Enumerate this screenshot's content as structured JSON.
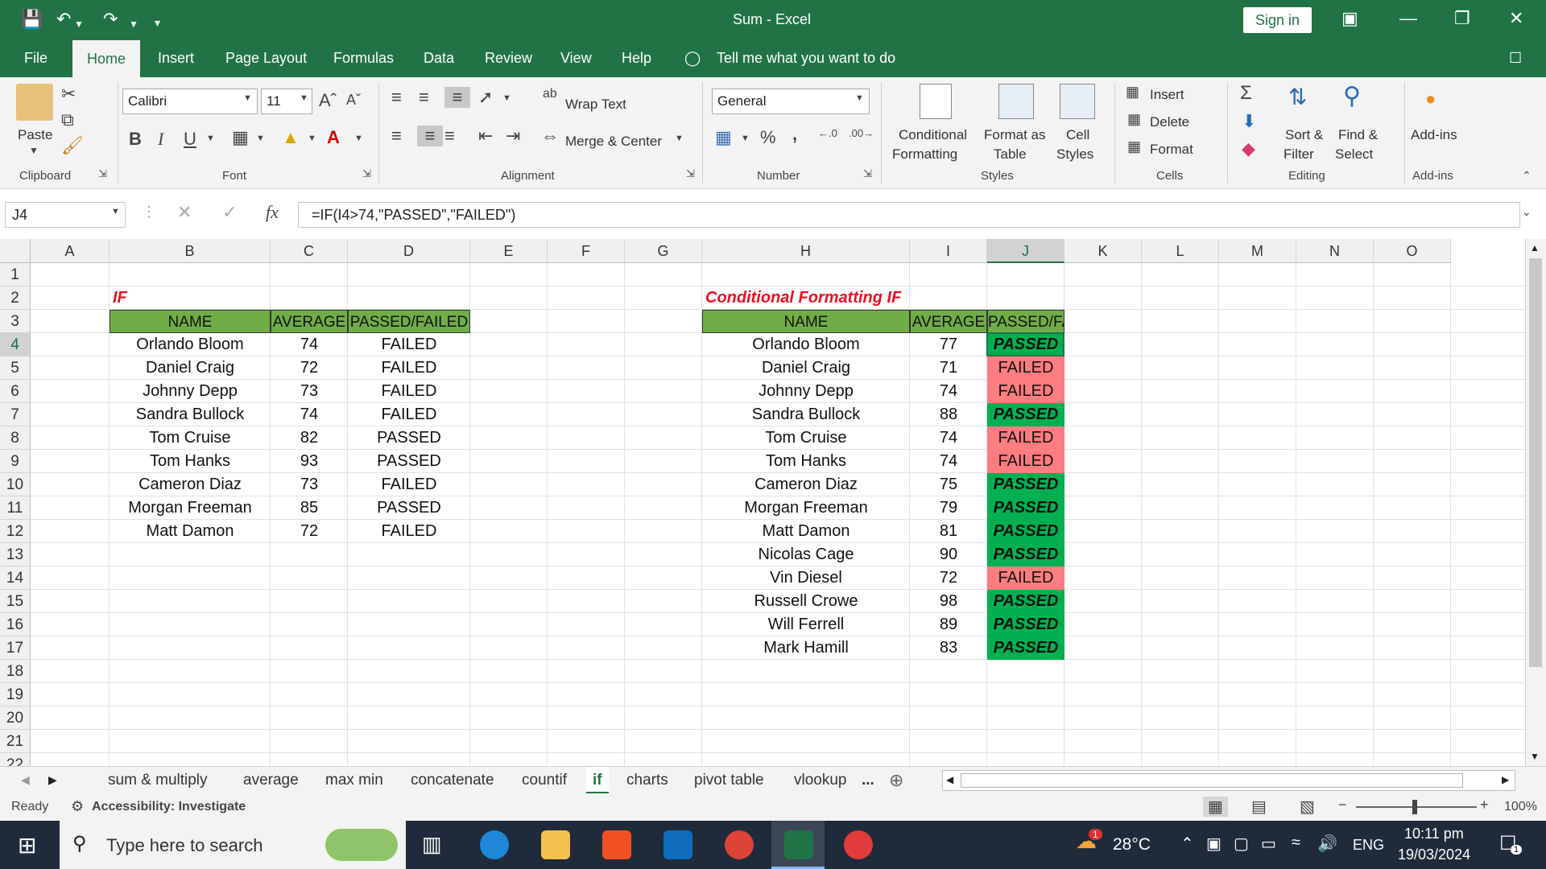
{
  "window": {
    "title": "Sum  -  Excel",
    "signin": "Sign in"
  },
  "tabs": [
    "File",
    "Home",
    "Insert",
    "Page Layout",
    "Formulas",
    "Data",
    "Review",
    "View",
    "Help"
  ],
  "tellme": "Tell me what you want to do",
  "ribbon": {
    "clipboard": {
      "paste": "Paste",
      "label": "Clipboard"
    },
    "font": {
      "name": "Calibri",
      "size": "11",
      "bold": "B",
      "italic": "I",
      "underline": "U",
      "label": "Font"
    },
    "alignment": {
      "wrap": "Wrap Text",
      "merge": "Merge & Center",
      "label": "Alignment"
    },
    "number": {
      "format": "General",
      "percent": "%",
      "comma": ",",
      "label": "Number"
    },
    "styles": {
      "conditional": "Conditional",
      "conditional2": "Formatting",
      "formatas": "Format as",
      "formatas2": "Table",
      "cell": "Cell",
      "cell2": "Styles",
      "label": "Styles"
    },
    "cells": {
      "insert": "Insert",
      "delete": "Delete",
      "format": "Format",
      "label": "Cells"
    },
    "editing": {
      "sort": "Sort &",
      "sort2": "Filter",
      "find": "Find &",
      "find2": "Select",
      "label": "Editing"
    },
    "addins": {
      "btn": "Add-ins",
      "label": "Add-ins"
    }
  },
  "formula_bar": {
    "namebox": "J4",
    "formula": "=IF(I4>74,\"PASSED\",\"FAILED\")"
  },
  "columns": [
    "A",
    "B",
    "C",
    "D",
    "E",
    "F",
    "G",
    "H",
    "I",
    "J",
    "K",
    "L",
    "M",
    "N",
    "O"
  ],
  "rows": [
    "1",
    "2",
    "3",
    "4",
    "5",
    "6",
    "7",
    "8",
    "9",
    "10",
    "11",
    "12",
    "13",
    "14",
    "15",
    "16",
    "17",
    "18",
    "19",
    "20",
    "21",
    "22"
  ],
  "table1": {
    "title": "IF",
    "headers": [
      "NAME",
      "AVERAGE",
      "PASSED/FAILED"
    ],
    "rows": [
      [
        "Orlando Bloom",
        "74",
        "FAILED"
      ],
      [
        "Daniel Craig",
        "72",
        "FAILED"
      ],
      [
        "Johnny Depp",
        "73",
        "FAILED"
      ],
      [
        "Sandra Bullock",
        "74",
        "FAILED"
      ],
      [
        "Tom Cruise",
        "82",
        "PASSED"
      ],
      [
        "Tom Hanks",
        "93",
        "PASSED"
      ],
      [
        "Cameron Diaz",
        "73",
        "FAILED"
      ],
      [
        "Morgan Freeman",
        "85",
        "PASSED"
      ],
      [
        "Matt Damon",
        "72",
        "FAILED"
      ]
    ]
  },
  "table2": {
    "title": "Conditional Formatting IF",
    "headers": [
      "NAME",
      "AVERAGE",
      "PASSED/FAILED"
    ],
    "rows": [
      [
        "Orlando Bloom",
        "77",
        "PASSED"
      ],
      [
        "Daniel Craig",
        "71",
        "FAILED"
      ],
      [
        "Johnny Depp",
        "74",
        "FAILED"
      ],
      [
        "Sandra Bullock",
        "88",
        "PASSED"
      ],
      [
        "Tom Cruise",
        "74",
        "FAILED"
      ],
      [
        "Tom Hanks",
        "74",
        "FAILED"
      ],
      [
        "Cameron Diaz",
        "75",
        "PASSED"
      ],
      [
        "Morgan Freeman",
        "79",
        "PASSED"
      ],
      [
        "Matt Damon",
        "81",
        "PASSED"
      ],
      [
        "Nicolas Cage",
        "90",
        "PASSED"
      ],
      [
        "Vin Diesel",
        "72",
        "FAILED"
      ],
      [
        "Russell Crowe",
        "98",
        "PASSED"
      ],
      [
        "Will Ferrell",
        "89",
        "PASSED"
      ],
      [
        "Mark Hamill",
        "83",
        "PASSED"
      ]
    ]
  },
  "colors": {
    "passed": "#00b050",
    "failed": "#ff7c80",
    "header": "#70ad47",
    "title_red": "#e81123",
    "excel_green": "#217346"
  },
  "sheets": [
    "sum & multiply",
    "average",
    "max min",
    "concatenate",
    "countif",
    "if",
    "charts",
    "pivot table",
    "vlookup"
  ],
  "sheets_more": "...",
  "status": {
    "ready": "Ready",
    "accessibility": "Accessibility: Investigate",
    "zoom": "100%"
  },
  "taskbar": {
    "search": "Type here to search",
    "temp": "28°C",
    "lang": "ENG",
    "time": "10:11 pm",
    "date": "19/03/2024",
    "notif": "1",
    "weather_badge": "1"
  }
}
